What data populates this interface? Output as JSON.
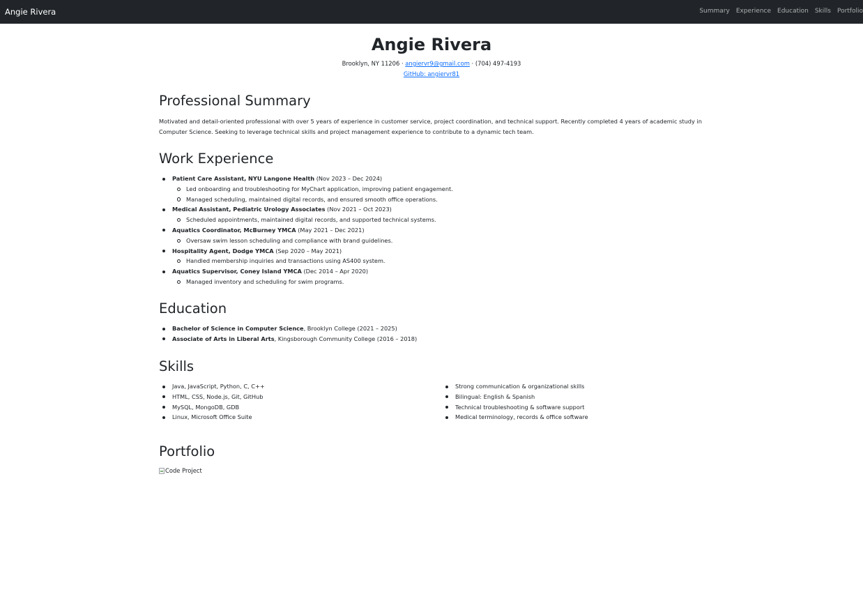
{
  "navbar": {
    "brand": "Angie Rivera",
    "links": [
      "Summary",
      "Experience",
      "Education",
      "Skills",
      "Portfolio"
    ]
  },
  "header": {
    "name": "Angie Rivera",
    "address": "Brooklyn, NY 11206 · ",
    "email": "angiervr9@gmail.com",
    "phone": " · (704) 497-4193",
    "github": "GitHub: angiervr81"
  },
  "summary": {
    "title": "Professional Summary",
    "text": "Motivated and detail-oriented professional with over 5 years of experience in customer service, project coordination, and technical support. Recently completed 4 years of academic study in Computer Science. Seeking to leverage technical skills and project management experience to contribute to a dynamic tech team."
  },
  "experience": {
    "title": "Work Experience",
    "jobs": [
      {
        "role": "Patient Care Assistant, NYU Langone Health",
        "dates": " (Nov 2023 – Dec 2024)",
        "duties": [
          "Led onboarding and troubleshooting for MyChart application, improving patient engagement.",
          "Managed scheduling, maintained digital records, and ensured smooth office operations."
        ]
      },
      {
        "role": "Medical Assistant, Pediatric Urology Associates",
        "dates": " (Nov 2021 – Oct 2023)",
        "duties": [
          "Scheduled appointments, maintained digital records, and supported technical systems."
        ]
      },
      {
        "role": "Aquatics Coordinator, McBurney YMCA",
        "dates": " (May 2021 – Dec 2021)",
        "duties": [
          "Oversaw swim lesson scheduling and compliance with brand guidelines."
        ]
      },
      {
        "role": "Hospitality Agent, Dodge YMCA",
        "dates": " (Sep 2020 – May 2021)",
        "duties": [
          "Handled membership inquiries and transactions using AS400 system."
        ]
      },
      {
        "role": "Aquatics Supervisor, Coney Island YMCA",
        "dates": " (Dec 2014 – Apr 2020)",
        "duties": [
          "Managed inventory and scheduling for swim programs."
        ]
      }
    ]
  },
  "education": {
    "title": "Education",
    "items": [
      {
        "degree": "Bachelor of Science in Computer Science",
        "detail": ", Brooklyn College (2021 – 2025)"
      },
      {
        "degree": "Associate of Arts in Liberal Arts",
        "detail": ", Kingsborough Community College (2016 – 2018)"
      }
    ]
  },
  "skills": {
    "title": "Skills",
    "left": [
      "Java, JavaScript, Python, C, C++",
      "HTML, CSS, Node.js, Git, GitHub",
      "MySQL, MongoDB, GDB",
      "Linux, Microsoft Office Suite"
    ],
    "right": [
      "Strong communication & organizational skills",
      "Bilingual: English & Spanish",
      "Technical troubleshooting & software support",
      "Medical terminology, records & office software"
    ]
  },
  "portfolio": {
    "title": "Portfolio",
    "image_alt": "Code Project"
  }
}
